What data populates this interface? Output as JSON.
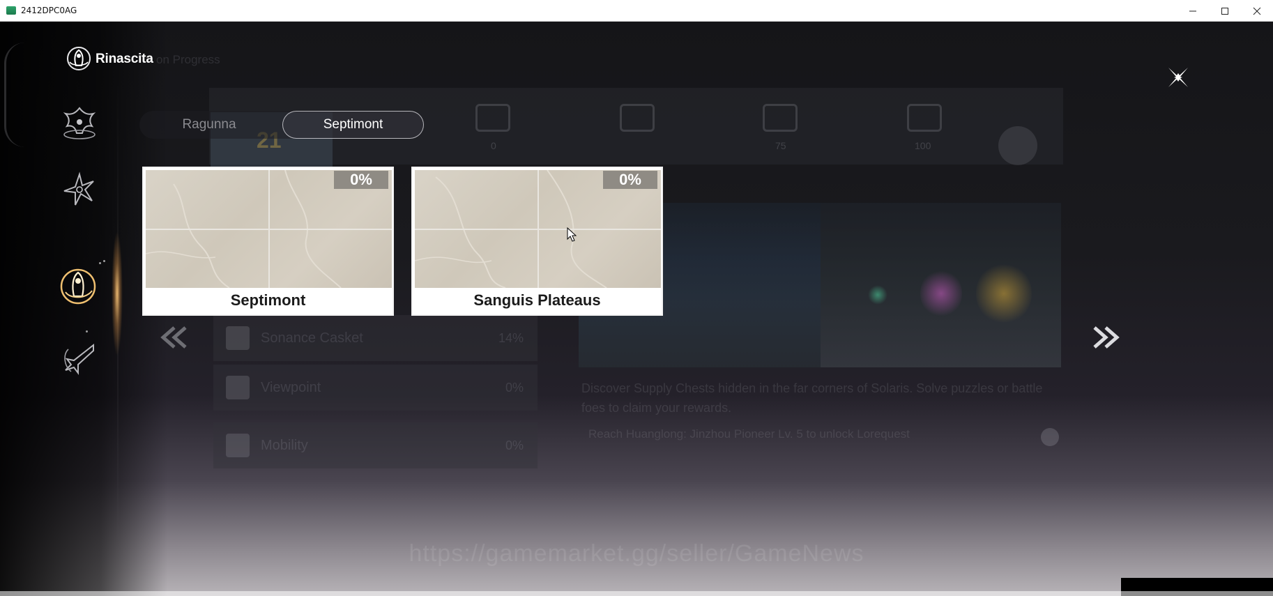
{
  "window": {
    "title": "2412DPC0AG"
  },
  "header": {
    "region_name": "Rinascita",
    "bg_text": "on Progress"
  },
  "tabs": [
    {
      "label": "Ragunna",
      "active": false
    },
    {
      "label": "Septimont",
      "active": true
    }
  ],
  "cards": [
    {
      "name": "Septimont",
      "progress": "0%"
    },
    {
      "name": "Sanguis Plateaus",
      "progress": "0%"
    }
  ],
  "background": {
    "score": "21",
    "chest_values": [
      "0",
      "75",
      "100"
    ],
    "rows": [
      {
        "label": "Sonance Casket",
        "value": "14%"
      },
      {
        "label": "Viewpoint",
        "value": "0%"
      },
      {
        "label": "Mobility",
        "value": "0%"
      }
    ],
    "description": "Discover Supply Chests hidden in the far corners of Solaris. Solve puzzles or battle foes to claim your rewards.",
    "hint": "Reach Huanglong: Jinzhou Pioneer Lv. 5 to unlock Lorequest"
  },
  "watermark": "https://gamemarket.gg/seller/GameNews",
  "icons": {
    "logo": "region-emblem-icon",
    "close": "close-icon",
    "prev": "double-chevron-left-icon",
    "next": "double-chevron-right-icon"
  },
  "colors": {
    "accent_gold": "#f0c070",
    "card_badge": "#8f8b84"
  }
}
